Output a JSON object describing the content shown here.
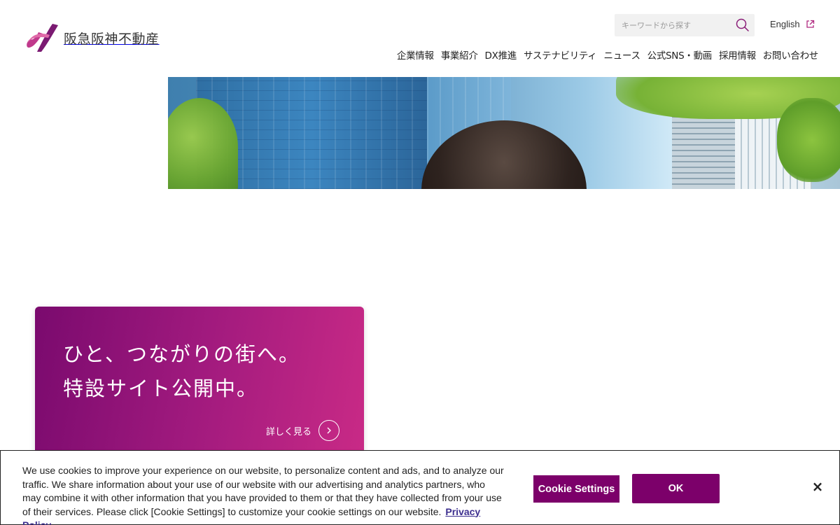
{
  "header": {
    "logo_text": "阪急阪神不動産",
    "search": {
      "placeholder": "キーワードから探す"
    },
    "language_link": "English",
    "nav": [
      "企業情報",
      "事業紹介",
      "DX推進",
      "サステナビリティ",
      "ニュース",
      "公式SNS・動画",
      "採用情報",
      "お問い合わせ"
    ]
  },
  "promo": {
    "line1": "ひと、つながりの街へ。",
    "line2": "特設サイト公開中。",
    "more_label": "詳しく見る"
  },
  "cookie": {
    "text": "We use cookies to improve your experience on our website, to personalize content and ads, and to analyze our traffic. We share information about your use of our website with our advertising and analytics partners, who may combine it with other information that you have provided to them or that they have collected from your use of their services. Please click [Cookie Settings] to customize your cookie settings on our website.",
    "privacy_link": "Privacy Policy",
    "settings_label": "Cookie Settings",
    "ok_label": "OK",
    "close_label": "×"
  },
  "colors": {
    "brand_purple": "#7c006a",
    "promo_gradient_start": "#7a0a6e",
    "promo_gradient_end": "#c92a86"
  },
  "icons": [
    "logo-mark-icon",
    "search-icon",
    "external-link-icon",
    "chevron-right-icon",
    "close-icon"
  ]
}
